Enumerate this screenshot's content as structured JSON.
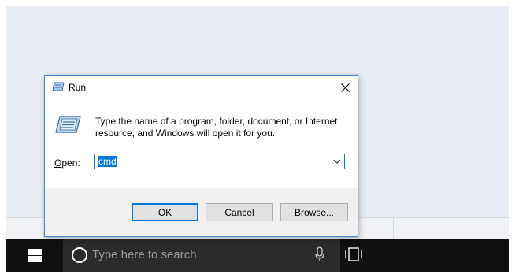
{
  "taskbar": {
    "search_placeholder": "Type here to search",
    "icons": [
      "windows-start-icon",
      "cortana-circle-icon",
      "microphone-icon",
      "task-view-icon"
    ]
  },
  "dialog": {
    "title": "Run",
    "description": "Type the name of a program, folder, document, or Internet resource, and Windows will open it for you.",
    "open_label_prefix": "O",
    "open_label_rest": "pen:",
    "open_value": "cmd",
    "buttons": {
      "ok": "OK",
      "cancel": "Cancel",
      "browse_prefix": "B",
      "browse_rest": "rowse..."
    }
  },
  "colors": {
    "accent": "#0078d7",
    "taskbar": "#101010",
    "search_box": "#2b2b2b",
    "dialog_bg": "#f0f0f0",
    "desktop": "#e8ecf5"
  }
}
